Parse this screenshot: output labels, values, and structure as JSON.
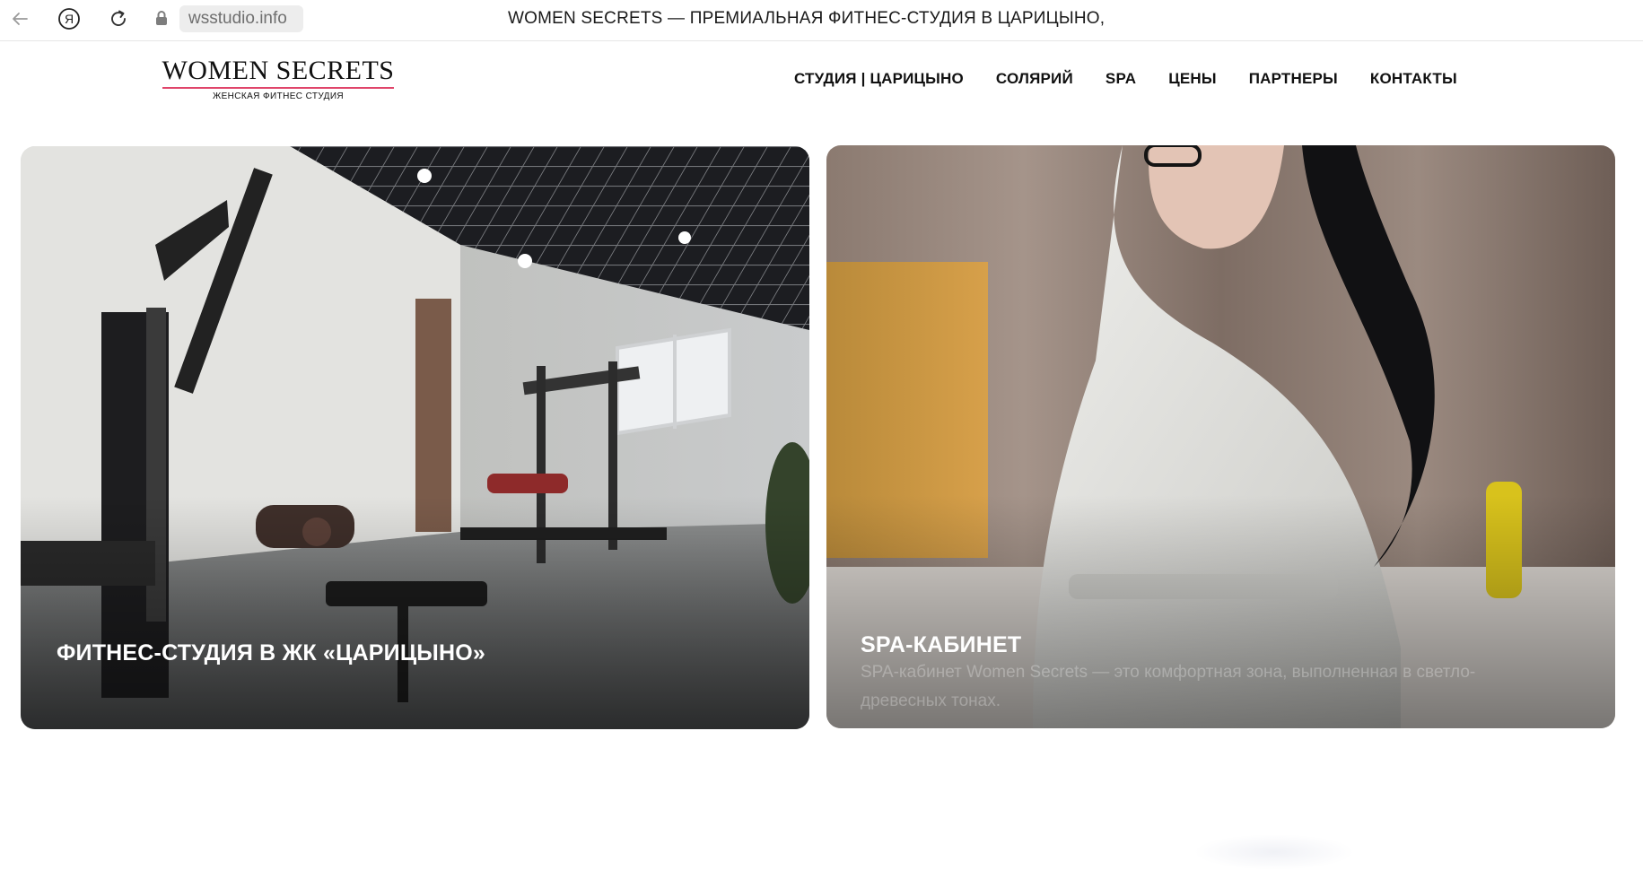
{
  "browser": {
    "url": "wsstudio.info",
    "tab_title": "WOMEN SECRETS — ПРЕМИАЛЬНАЯ ФИТНЕС-СТУДИЯ В ЦАРИЦЫНО,",
    "icons": [
      "back-arrow-icon",
      "yandex-icon",
      "reload-icon",
      "lock-icon"
    ]
  },
  "site": {
    "logo_name": "WOMEN SECRETS",
    "logo_sub": "ЖЕНСКАЯ ФИТНЕС СТУДИЯ",
    "accent_color": "#e0456a",
    "nav": [
      {
        "label": "СТУДИЯ | ЦАРИЦЫНО"
      },
      {
        "label": "СОЛЯРИЙ"
      },
      {
        "label": "SPA"
      },
      {
        "label": "ЦЕНЫ"
      },
      {
        "label": "ПАРТНЕРЫ"
      },
      {
        "label": "КОНТАКТЫ"
      }
    ]
  },
  "cards": [
    {
      "title": "ФИТНЕС-СТУДИЯ В ЖК «ЦАРИЦЫНО»",
      "description": ""
    },
    {
      "title": "SPA-КАБИНЕТ",
      "description": "SPA-кабинет Women Secrets — это комфортная зона, выполненная в светло-древесных тонах."
    }
  ]
}
